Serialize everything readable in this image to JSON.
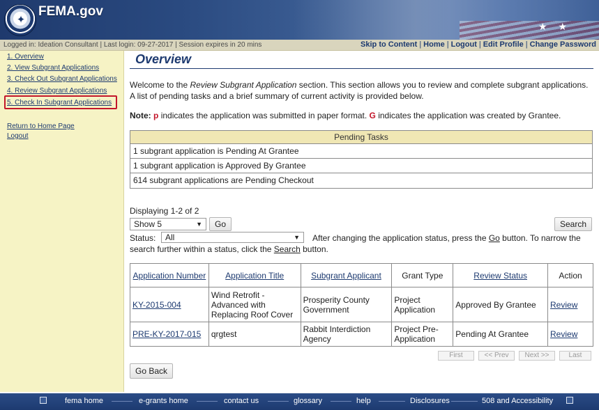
{
  "header": {
    "brand": "FEMA.gov",
    "stars": "★ ★"
  },
  "statusbar": {
    "logged_in": "Logged in: Ideation Consultant  |  Last login: 09-27-2017  |  Session expires in 20 mins",
    "links": [
      "Skip to Content",
      "Home",
      "Logout",
      "Edit Profile",
      "Change Password"
    ]
  },
  "sidebar": {
    "items": [
      "1. Overview",
      "2. View Subgrant Applications",
      "3. Check Out Subgrant Applications",
      "4. Review Subgrant Applications",
      "5. Check In Subgrant Applications"
    ],
    "return_home": "Return to Home Page",
    "logout": "Logout"
  },
  "main": {
    "title": "Overview",
    "intro_a": "Welcome to the ",
    "intro_em": "Review Subgrant Application",
    "intro_b": " section. This section allows you to review and complete subgrant applications. A list of pending tasks and a brief summary of current activity is provided below.",
    "note_label": "Note:",
    "note_p": "p",
    "note_mid": " indicates the application was submitted in paper format. ",
    "note_g": "G",
    "note_end": " indicates the application was created by Grantee."
  },
  "pending": {
    "header": "Pending Tasks",
    "rows": [
      "1 subgrant application is Pending At Grantee",
      "1 subgrant application is Approved By Grantee",
      "614 subgrant applications are Pending Checkout"
    ]
  },
  "controls": {
    "displaying": "Displaying 1-2 of 2",
    "show_value": "Show 5",
    "go_label": "Go",
    "search_label": "Search",
    "status_label": "Status:",
    "status_value": "All",
    "help_a": "After changing the application status, press the ",
    "help_go": "Go",
    "help_b": " button. To narrow the",
    "help_c": "search further within a status, click the ",
    "help_search": "Search",
    "help_d": " button."
  },
  "table": {
    "headers": [
      "Application Number",
      "Application Title",
      "Subgrant Applicant",
      "Grant Type",
      "Review Status",
      "Action"
    ],
    "rows": [
      {
        "number": "KY-2015-004",
        "title": "Wind Retrofit - Advanced with Replacing Roof Cover",
        "applicant": "Prosperity County Government",
        "grant_type": "Project Application",
        "status": "Approved By Grantee",
        "action": "Review"
      },
      {
        "number": "PRE-KY-2017-015",
        "title": "qrgtest",
        "applicant": "Rabbit Interdiction Agency",
        "grant_type": "Project Pre-Application",
        "status": "Pending At Grantee",
        "action": "Review"
      }
    ]
  },
  "pager": {
    "first": "First",
    "prev": "<< Prev",
    "next": "Next >>",
    "last": "Last"
  },
  "go_back": "Go Back",
  "footer": {
    "links": [
      "fema home",
      "e-grants home",
      "contact us",
      "glossary",
      "help",
      "Disclosures",
      "508 and Accessibility"
    ]
  },
  "colors": {
    "accent": "#1d3a70",
    "highlight": "#c3162a",
    "sidebar_bg": "#f6f3c5",
    "table_header_bg": "#f0e7b4"
  }
}
